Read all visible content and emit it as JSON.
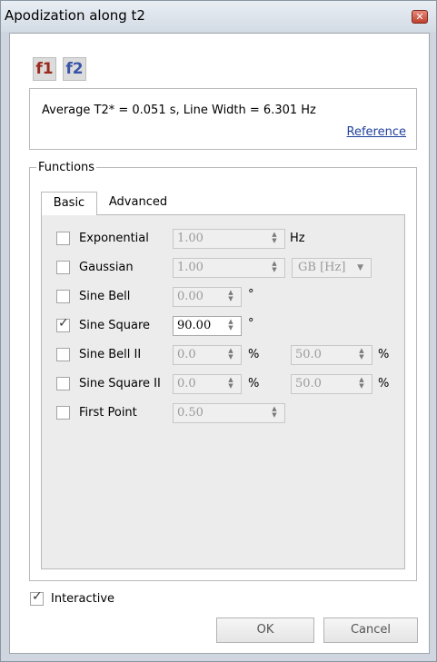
{
  "window": {
    "title": "Apodization along t2",
    "close_glyph": "✕"
  },
  "dimension_buttons": [
    {
      "label": "f1",
      "color": "#9b2a1d"
    },
    {
      "label": "f2",
      "color": "#3a55a6"
    }
  ],
  "info": {
    "text": "Average T2* = 0.051 s, Line Width = 6.301 Hz",
    "reference_link": "Reference"
  },
  "functions_group": {
    "title": "Functions",
    "tabs": [
      {
        "label": "Basic",
        "active": true
      },
      {
        "label": "Advanced",
        "active": false
      }
    ],
    "rows": [
      {
        "label": "Exponential",
        "checked": false,
        "value": "1.00",
        "enabled": false,
        "unit": "Hz"
      },
      {
        "label": "Gaussian",
        "checked": false,
        "value": "1.00",
        "enabled": false,
        "select": "GB [Hz]"
      },
      {
        "label": "Sine Bell",
        "checked": false,
        "value": "0.00",
        "enabled": false,
        "unit": "°"
      },
      {
        "label": "Sine Square",
        "checked": true,
        "value": "90.00",
        "enabled": true,
        "unit": "°"
      },
      {
        "label": "Sine Bell II",
        "checked": false,
        "value": "0.0",
        "enabled": false,
        "unit": "%",
        "value2": "50.0",
        "unit2": "%"
      },
      {
        "label": "Sine Square II",
        "checked": false,
        "value": "0.0",
        "enabled": false,
        "unit": "%",
        "value2": "50.0",
        "unit2": "%"
      },
      {
        "label": "First Point",
        "checked": false,
        "value": "0.50",
        "enabled": false
      }
    ]
  },
  "interactive": {
    "label": "Interactive",
    "checked": true
  },
  "buttons": {
    "ok": "OK",
    "cancel": "Cancel"
  },
  "icons": {
    "checkmark": "✓",
    "spin_up": "▲",
    "spin_down": "▼",
    "dropdown": "▼"
  }
}
